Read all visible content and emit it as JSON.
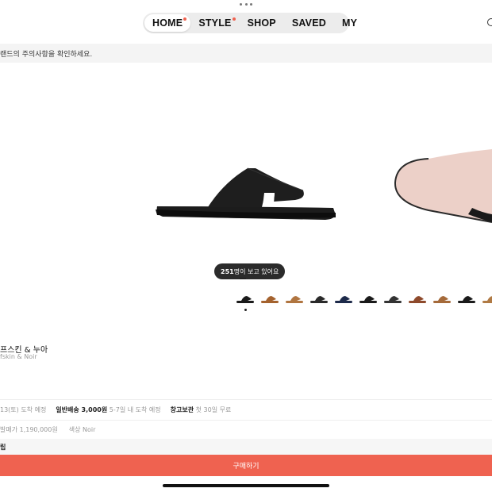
{
  "top_tabs": [
    {
      "label": "HOME",
      "active": true,
      "badge": true
    },
    {
      "label": "STYLE",
      "active": false,
      "badge": true
    },
    {
      "label": "SHOP",
      "active": false,
      "badge": false
    },
    {
      "label": "SAVED",
      "active": false,
      "badge": false
    },
    {
      "label": "MY",
      "active": false,
      "badge": false
    }
  ],
  "notice": "랜드의 주의사항을 확인하세요.",
  "gallery": {
    "viewers_count": "251",
    "viewers_suffix": "명이 보고 있어요",
    "thumbnail_colors": [
      "#1a1a1a",
      "#a4622e",
      "#b07540",
      "#2a2a2a",
      "#1d2a4a",
      "#1a1a1a",
      "#333333",
      "#8e4a2c",
      "#a56a3a",
      "#1a1a1a",
      "#b07a44"
    ]
  },
  "product": {
    "name_ko": "프스킨 & 누아",
    "name_en": "fskin & Noir"
  },
  "delivery": {
    "express_text": "13(토) 도착 예정",
    "standard_label": "일반배송 3,000원",
    "standard_detail": "5-7일 내 도착 예정",
    "storage_label": "창고보관",
    "storage_detail": "첫 30일 무료"
  },
  "meta": {
    "release_price": "발매가 1,190,000원",
    "color": "색상 Noir"
  },
  "section_title": "립",
  "buy_button": "구매하기",
  "colors": {
    "accent": "#ef6250"
  }
}
